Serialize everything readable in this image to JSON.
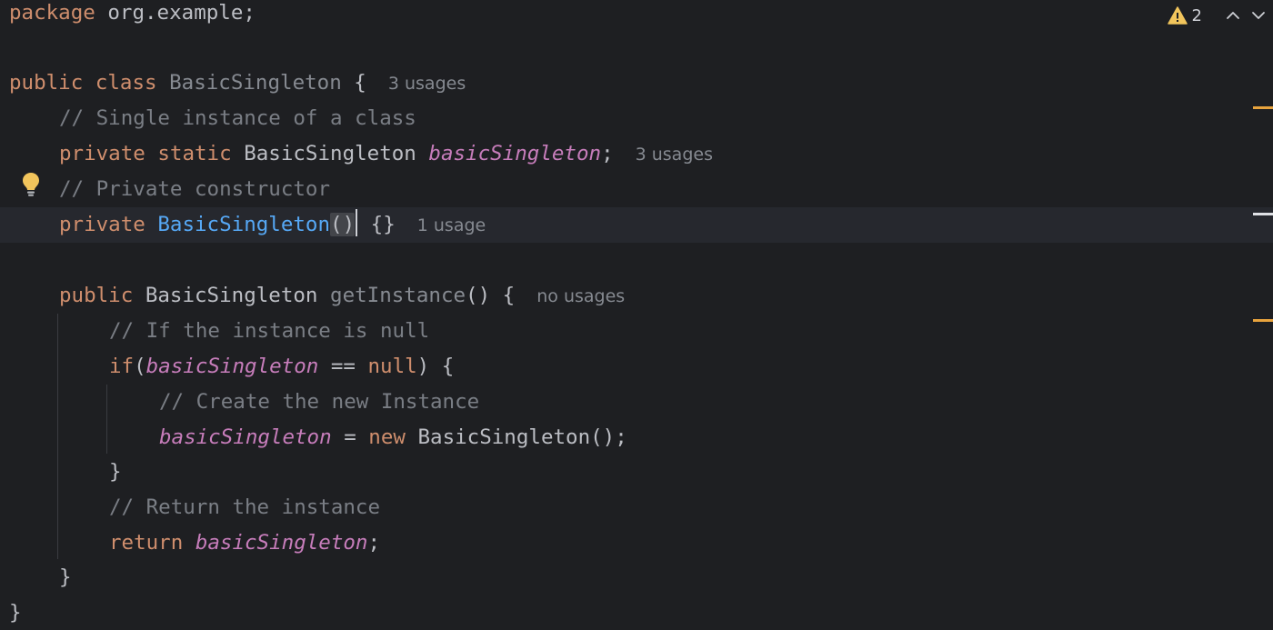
{
  "editor": {
    "inspection": {
      "warning_icon": "warning-triangle-icon",
      "warning_count": "2",
      "prev_icon": "chevron-up-icon",
      "next_icon": "chevron-down-icon"
    },
    "lines": {
      "l1": {
        "kw": "package",
        "rest": " org.example;"
      },
      "l3": {
        "kw1": "public",
        "kw2": "class",
        "name": "BasicSingleton",
        "brace": " {",
        "usages": "3 usages"
      },
      "l4": {
        "comment": "// Single instance of a class"
      },
      "l5": {
        "kw1": "private",
        "kw2": "static",
        "type": "BasicSingleton",
        "field": "basicSingleton",
        "semi": ";",
        "usages": "3 usages"
      },
      "l6": {
        "comment": "// Private constructor"
      },
      "l7": {
        "kw": "private",
        "name": "BasicSingleton",
        "parens": "()",
        "body": "{}",
        "usages": "1 usage"
      },
      "l9": {
        "kw": "public",
        "type": "BasicSingleton",
        "name": "getInstance",
        "rest": "() {",
        "usages": "no usages"
      },
      "l10": {
        "comment": "// If the instance is null"
      },
      "l11": {
        "kw_if": "if",
        "open": "(",
        "field": "basicSingleton",
        "op": " == ",
        "kw_null": "null",
        "close": ") {"
      },
      "l12": {
        "comment": "// Create the new Instance"
      },
      "l13": {
        "field": "basicSingleton",
        "op": " = ",
        "kw_new": "new",
        "rest": " BasicSingleton();"
      },
      "l14": {
        "brace": "}"
      },
      "l15": {
        "comment": "// Return the instance"
      },
      "l16": {
        "kw": "return",
        "field": "basicSingleton",
        "semi": ";"
      },
      "l17": {
        "brace": "}"
      },
      "l18": {
        "brace": "}"
      }
    },
    "colors": {
      "background": "#1e1f22",
      "keyword": "#cf8e6d",
      "comment": "#7a7e85",
      "field": "#c77dbb",
      "method_declaration": "#56a8f5",
      "warning_marker": "#e8a33d"
    }
  }
}
